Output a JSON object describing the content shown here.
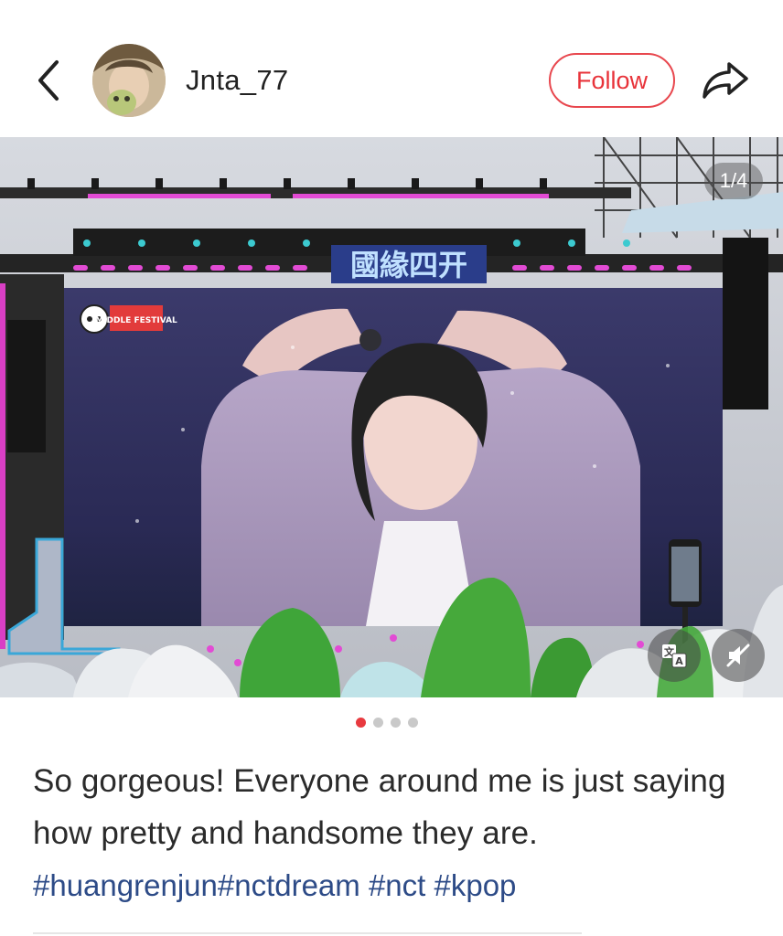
{
  "header": {
    "back_icon": "chevron-left-icon",
    "username": "Jnta_77",
    "follow_label": "Follow",
    "share_icon": "share-arrow-icon"
  },
  "photo": {
    "counter": "1/4",
    "stage_banner": "國緣四开",
    "logo_text": "MIDDLE FESTIVAL",
    "translate_icon": "translate-icon",
    "mute_icon": "mute-icon"
  },
  "pager": {
    "total": 4,
    "active_index": 0,
    "active_color": "#e83a3f"
  },
  "post": {
    "caption": "So gorgeous! Everyone around me is just saying how pretty and handsome they are.",
    "hashtags": [
      "#huangrenjun",
      "#nctdream",
      " #nct",
      " #kpop"
    ]
  },
  "colors": {
    "accent": "#e8333a",
    "hashtag": "#2d4b87"
  }
}
